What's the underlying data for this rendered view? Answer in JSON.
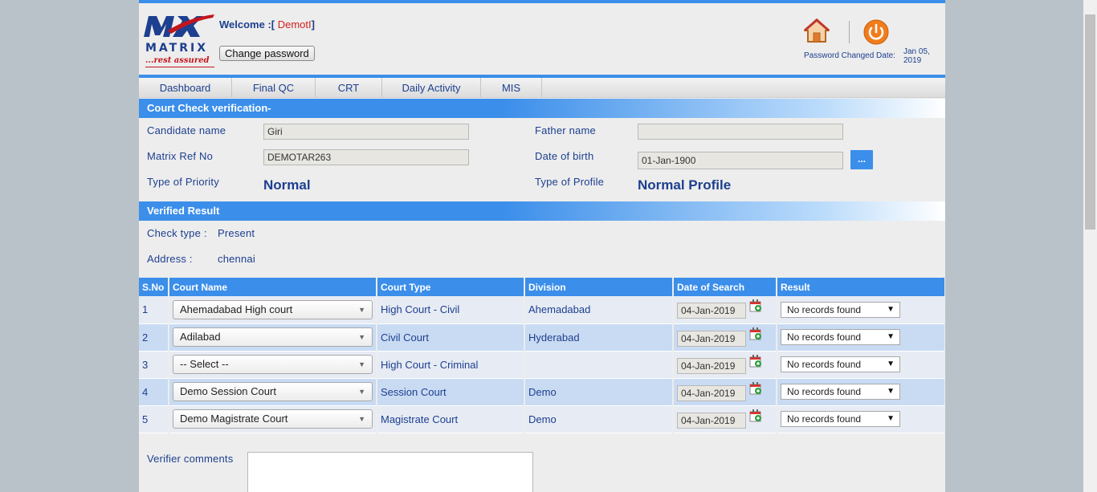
{
  "header": {
    "logo_brand": "MATRIX",
    "logo_tagline": "...rest assured",
    "welcome_label": "Welcome :[",
    "welcome_user": " DemotI",
    "welcome_close": "]",
    "change_password": "Change password",
    "password_changed_label": "Password Changed Date:",
    "password_changed_date": "Jan 05, 2019",
    "home_icon": "home-icon",
    "power_icon": "power-icon"
  },
  "menu": [
    "Dashboard",
    "Final QC",
    "CRT",
    "Daily Activity",
    "MIS"
  ],
  "court_check": {
    "title": "Court Check verification-",
    "candidate_name_label": "Candidate name",
    "candidate_name": "Giri",
    "father_name_label": "Father name",
    "father_name": "",
    "matrix_ref_label": "Matrix Ref No",
    "matrix_ref": "DEMOTAR263",
    "dob_label": "Date of birth",
    "dob": "01-Jan-1900",
    "dob_button": "...",
    "priority_label": "Type of Priority",
    "priority": "Normal",
    "profile_label": "Type of Profile",
    "profile": "Normal Profile"
  },
  "verified": {
    "title": "Verified Result",
    "check_type_label": "Check type :",
    "check_type": "Present",
    "address_label": "Address :",
    "address": "chennai"
  },
  "table": {
    "headers": [
      "S.No",
      "Court Name",
      "Court Type",
      "Division",
      "Date of Search",
      "Result"
    ],
    "rows": [
      {
        "sno": "1",
        "court_name": "Ahemadabad High court",
        "court_type": "High Court - Civil",
        "division": "Ahemadabad",
        "date": "04-Jan-2019",
        "result": "No records found"
      },
      {
        "sno": "2",
        "court_name": "Adilabad",
        "court_type": "Civil Court",
        "division": "Hyderabad",
        "date": "04-Jan-2019",
        "result": "No records found"
      },
      {
        "sno": "3",
        "court_name": "-- Select --",
        "court_type": "High Court - Criminal",
        "division": "",
        "date": "04-Jan-2019",
        "result": "No records found"
      },
      {
        "sno": "4",
        "court_name": "Demo Session Court",
        "court_type": "Session Court",
        "division": "Demo",
        "date": "04-Jan-2019",
        "result": "No records found"
      },
      {
        "sno": "5",
        "court_name": "Demo Magistrate Court",
        "court_type": "Magistrate Court",
        "division": "Demo",
        "date": "04-Jan-2019",
        "result": "No records found"
      }
    ]
  },
  "verifier_comments_label": "Verifier comments",
  "colors": {
    "accent": "#3b8eea",
    "text": "#1d3f8f",
    "brand_red": "#c4151b"
  }
}
